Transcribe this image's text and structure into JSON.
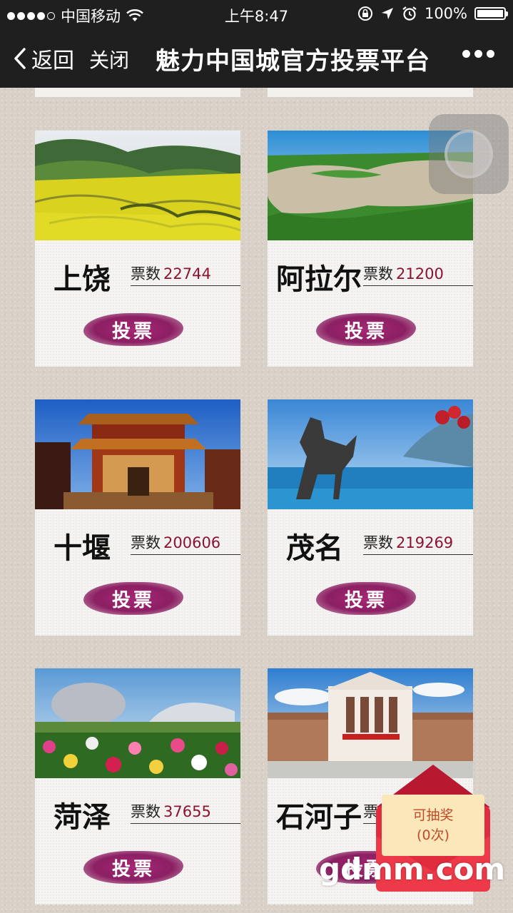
{
  "status_bar": {
    "carrier": "中国移动",
    "time": "上午8:47",
    "battery": "100%",
    "battery_level": 1.0
  },
  "nav": {
    "back_label": "返回",
    "close_label": "关闭",
    "title": "魅力中国城官方投票平台"
  },
  "cards": [
    {
      "name": "上饶",
      "votes_label": "票数",
      "votes": "22744",
      "button": "投票"
    },
    {
      "name": "阿拉尔",
      "votes_label": "票数",
      "votes": "21200",
      "button": "投票"
    },
    {
      "name": "十堰",
      "votes_label": "票数",
      "votes": "200606",
      "button": "投票"
    },
    {
      "name": "茂名",
      "votes_label": "票数",
      "votes": "219269",
      "button": "投票"
    },
    {
      "name": "菏泽",
      "votes_label": "票数",
      "votes": "37655",
      "button": "投票"
    },
    {
      "name": "石河子",
      "votes_label": "票数",
      "votes": "",
      "button": "投票"
    }
  ],
  "lottery": {
    "label": "可抽奖",
    "count": "(0次)"
  },
  "watermark": "gdmm.com"
}
